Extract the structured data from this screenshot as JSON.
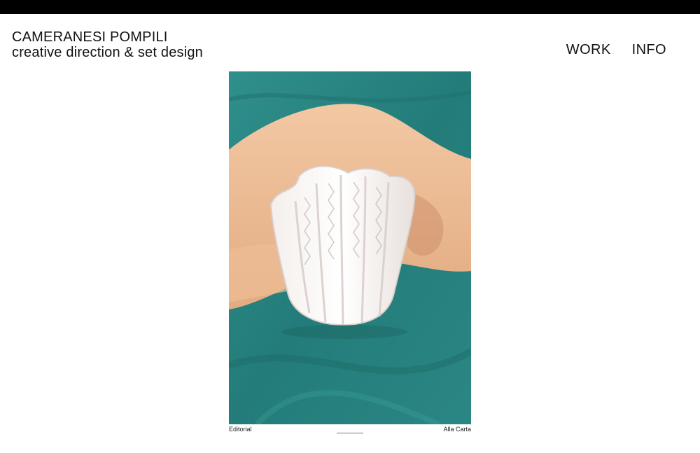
{
  "site": {
    "name": "CAMERANESI POMPILI",
    "tagline": "creative direction & set design"
  },
  "nav": {
    "items": [
      {
        "label": "WORK"
      },
      {
        "label": "INFO"
      }
    ]
  },
  "gallery": {
    "caption_left": "Editorial",
    "caption_right": "Alla Carta"
  },
  "colors": {
    "topbar": "#000000",
    "fabric": "#2a8a86"
  }
}
